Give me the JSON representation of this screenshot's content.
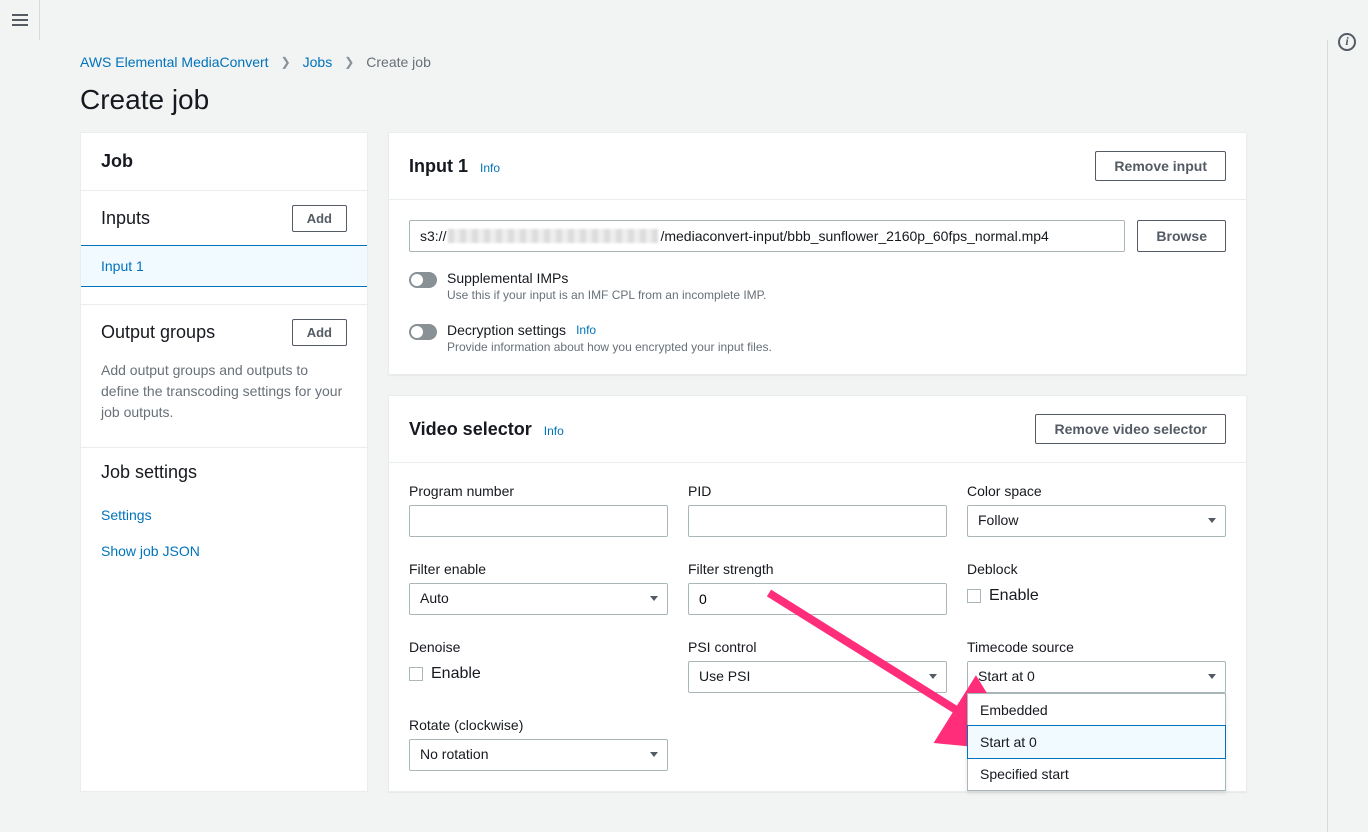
{
  "breadcrumb": {
    "root": "AWS Elemental MediaConvert",
    "jobs": "Jobs",
    "current": "Create job"
  },
  "page_title": "Create job",
  "sidebar": {
    "job_header": "Job",
    "inputs_label": "Inputs",
    "inputs_add": "Add",
    "input_item": "Input 1",
    "output_groups_label": "Output groups",
    "output_groups_add": "Add",
    "output_groups_desc": "Add output groups and outputs to define the transcoding settings for your job outputs.",
    "job_settings_label": "Job settings",
    "settings_link": "Settings",
    "show_json_link": "Show job JSON"
  },
  "input_panel": {
    "title": "Input 1",
    "info": "Info",
    "remove_btn": "Remove input",
    "url_prefix": "s3://",
    "url_suffix": "/mediaconvert-input/bbb_sunflower_2160p_60fps_normal.mp4",
    "browse_btn": "Browse",
    "supp_imps_label": "Supplemental IMPs",
    "supp_imps_desc": "Use this if your input is an IMF CPL from an incomplete IMP.",
    "decrypt_label": "Decryption settings",
    "decrypt_desc": "Provide information about how you encrypted your input files."
  },
  "video_panel": {
    "title": "Video selector",
    "info": "Info",
    "remove_btn": "Remove video selector",
    "program_number_label": "Program number",
    "pid_label": "PID",
    "color_space_label": "Color space",
    "color_space_value": "Follow",
    "filter_enable_label": "Filter enable",
    "filter_enable_value": "Auto",
    "filter_strength_label": "Filter strength",
    "filter_strength_value": "0",
    "deblock_label": "Deblock",
    "enable_label": "Enable",
    "denoise_label": "Denoise",
    "psi_control_label": "PSI control",
    "psi_control_value": "Use PSI",
    "timecode_source_label": "Timecode source",
    "timecode_source_value": "Start at 0",
    "timecode_options": {
      "embedded": "Embedded",
      "start_at_0": "Start at 0",
      "specified": "Specified start"
    },
    "rotate_label": "Rotate (clockwise)",
    "rotate_value": "No rotation"
  }
}
